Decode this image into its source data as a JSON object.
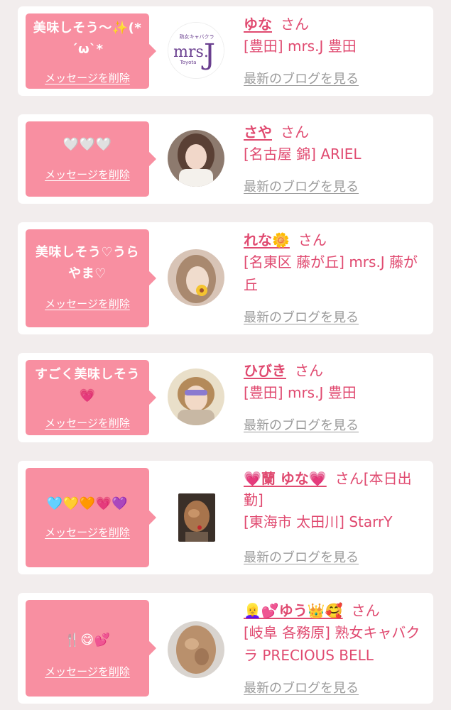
{
  "delete_label": "メッセージを削除",
  "blog_label": "最新のブログを見る",
  "honorific": "さん",
  "colors": {
    "bubble": "#f88fa1",
    "accent": "#e04a70",
    "link_gray": "#9a9a9a",
    "background": "#f2eded"
  },
  "cards": [
    {
      "message": "美味しそう〜✨(*´ω`*",
      "name": "ゆな",
      "honorific_suffix": "",
      "shop": "[豊田] mrs.J 豊田",
      "avatar_icon": "mrs-j-logo-icon",
      "logo_text": "mrs.",
      "logo_letter": "J",
      "logo_top": "熟女キャバクラ",
      "logo_bottom": "Toyota"
    },
    {
      "message": "🤍🤍🤍",
      "name": "さや",
      "honorific_suffix": "",
      "shop": "[名古屋 錦] ARIEL",
      "avatar_icon": "profile-photo-icon"
    },
    {
      "message": "美味しそう♡うらやま♡",
      "name": "れな🌼",
      "honorific_suffix": "",
      "shop": "[名東区 藤が丘] mrs.J 藤が丘",
      "avatar_icon": "profile-photo-icon"
    },
    {
      "message": "すごく美味しそう💗",
      "name": "ひびき",
      "honorific_suffix": "",
      "shop": "[豊田] mrs.J 豊田",
      "avatar_icon": "profile-photo-icon"
    },
    {
      "message": "🩵💛🧡💗💜",
      "name": "💗蘭 ゆな💗",
      "honorific_suffix": "[本日出勤]",
      "shop": "[東海市 太田川] StarrY",
      "avatar_icon": "profile-photo-icon"
    },
    {
      "message": "🍴😋💕",
      "name": "👱‍♀️💕ゆう👑🥰",
      "honorific_suffix": "",
      "shop": "[岐阜 各務原]  熟女キャバクラ PRECIOUS BELL",
      "avatar_icon": "profile-photo-icon"
    }
  ]
}
